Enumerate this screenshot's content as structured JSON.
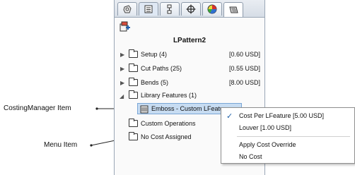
{
  "panel": {
    "title": "LPattern2",
    "tabs": [
      {
        "icon": "part-rotate-icon"
      },
      {
        "icon": "property-manager-icon",
        "selected": true
      },
      {
        "icon": "configuration-icon"
      },
      {
        "icon": "crosshair-icon"
      },
      {
        "icon": "appearance-icon"
      },
      {
        "icon": "costing-manager-icon",
        "active": true
      }
    ],
    "toolbar_icon": "costing-tool-icon",
    "tree": [
      {
        "label": "Setup (4)",
        "cost": "[0.60 USD]",
        "expandable": true
      },
      {
        "label": "Cut Paths (25)",
        "cost": "[0.55 USD]",
        "expandable": true
      },
      {
        "label": "Bends (5)",
        "cost": "[8.00 USD]",
        "expandable": true
      },
      {
        "label": "Library Features (1)",
        "cost": "",
        "expanded": true
      },
      {
        "label": "Emboss - Custom LFeature",
        "cost": "",
        "selected": true
      },
      {
        "label": "Custom Operations",
        "cost": ""
      },
      {
        "label": "No Cost Assigned",
        "cost": ""
      }
    ]
  },
  "context_menu": {
    "items": [
      {
        "label": "Cost Per LFeature [5.00 USD]",
        "checked": true
      },
      {
        "label": "Louver [1.00 USD]",
        "checked": false
      },
      {
        "label": "Apply Cost Override",
        "checked": false
      },
      {
        "label": "No Cost",
        "checked": false
      }
    ],
    "check_glyph": "✓"
  },
  "callouts": {
    "costing_manager_item": "CostingManager Item",
    "menu_item": "Menu Item"
  },
  "colors": {
    "selection": "#c7dcf2",
    "panel_border": "#9aa7b6"
  }
}
